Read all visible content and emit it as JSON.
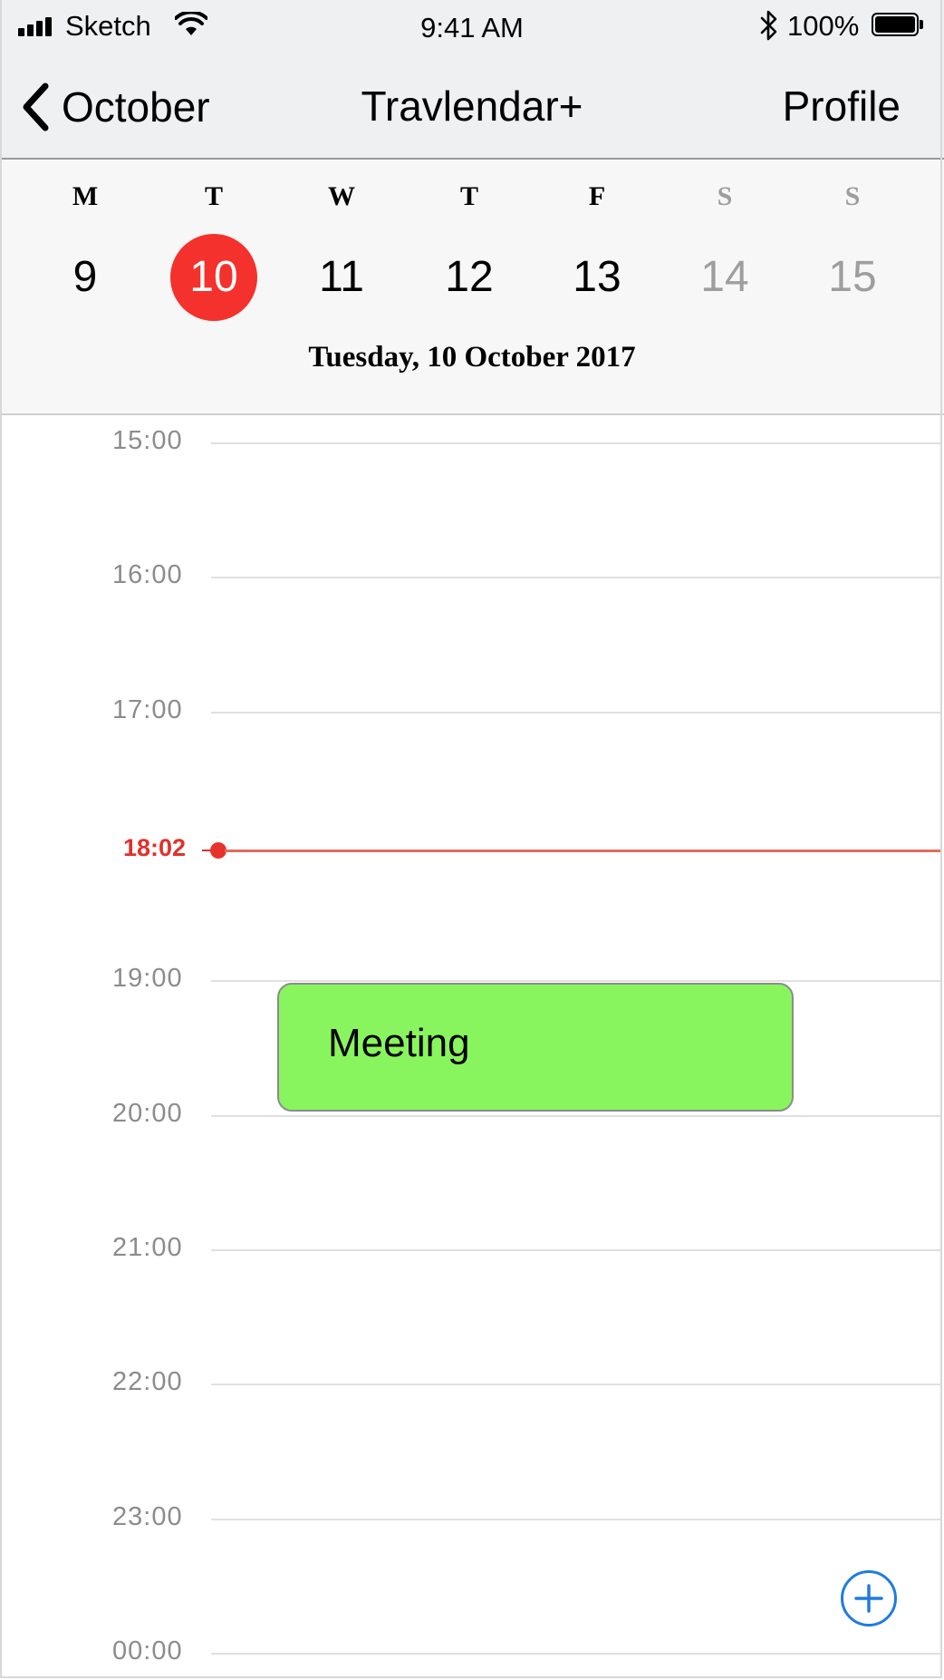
{
  "status_bar": {
    "carrier": "Sketch",
    "time": "9:41 AM",
    "battery_percent": "100%",
    "icons": [
      "signal-icon",
      "wifi-icon",
      "bluetooth-icon",
      "battery-icon"
    ]
  },
  "nav": {
    "back_label": "October",
    "title": "Travlendar+",
    "profile_label": "Profile"
  },
  "week": {
    "days": [
      {
        "letter": "M",
        "number": "9"
      },
      {
        "letter": "T",
        "number": "10"
      },
      {
        "letter": "W",
        "number": "11"
      },
      {
        "letter": "T",
        "number": "12"
      },
      {
        "letter": "F",
        "number": "13"
      },
      {
        "letter": "S",
        "number": "14"
      },
      {
        "letter": "S",
        "number": "15"
      }
    ],
    "selected_index": 1,
    "date_heading": "Tuesday, 10 October 2017"
  },
  "timeline": {
    "hours": [
      "15:00",
      "16:00",
      "17:00",
      "19:00",
      "20:00",
      "21:00",
      "22:00",
      "23:00",
      "00:00"
    ],
    "now_label": "18:02",
    "events": [
      {
        "title": "Meeting",
        "color": "#89f55e"
      }
    ]
  },
  "colors": {
    "accent_red": "#f4312c",
    "event_green": "#89f55e",
    "add_blue": "#1f7ce0"
  }
}
